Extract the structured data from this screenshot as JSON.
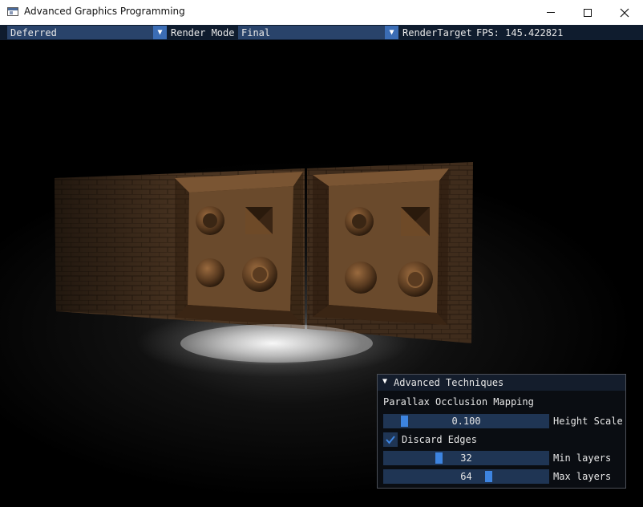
{
  "window": {
    "title": "Advanced Graphics Programming"
  },
  "menubar": {
    "renderer": {
      "value": "Deferred"
    },
    "render_mode": {
      "label": "Render Mode",
      "value": "Final"
    },
    "render_target_label": "RenderTarget",
    "fps": "FPS: 145.422821"
  },
  "panel": {
    "title": "Advanced Techniques",
    "section": "Parallax Occlusion Mapping",
    "height_scale": {
      "value": "0.100",
      "label": "Height Scale",
      "fraction": 0.1
    },
    "discard_edges": {
      "label": "Discard Edges",
      "checked": true
    },
    "min_layers": {
      "value": "32",
      "label": "Min layers"
    },
    "max_layers": {
      "value": "64",
      "label": "Max layers"
    }
  },
  "colors": {
    "accent": "#3d84e0",
    "frame": "#29436a",
    "menubar_bg": "#0f1c2e"
  },
  "icons": [
    "app-icon",
    "minimize-icon",
    "maximize-icon",
    "close-icon",
    "dropdown-arrow-icon",
    "collapse-triangle-icon",
    "checkmark-icon"
  ]
}
